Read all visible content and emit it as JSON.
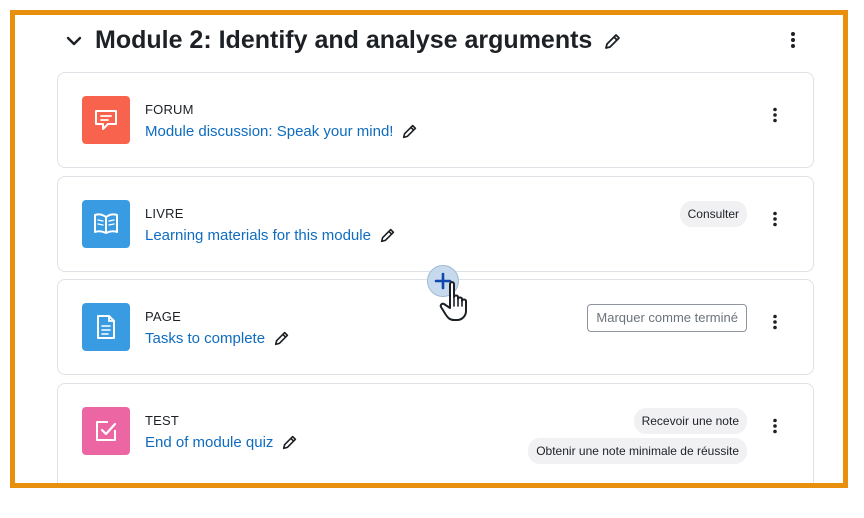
{
  "section": {
    "title": "Module 2: Identify and analyse arguments"
  },
  "activities": [
    {
      "type": "FORUM",
      "name": "Module discussion: Speak your mind!",
      "icon": "forum-icon",
      "color": "#f7634d"
    },
    {
      "type": "LIVRE",
      "name": "Learning materials for this module",
      "icon": "book-icon",
      "color": "#399be2",
      "badges": [
        "Consulter"
      ]
    },
    {
      "type": "PAGE",
      "name": "Tasks to complete",
      "icon": "page-icon",
      "color": "#399be2",
      "completion_button": "Marquer comme terminé"
    },
    {
      "type": "TEST",
      "name": "End of module quiz",
      "icon": "quiz-icon",
      "color": "#eb66a2",
      "badges": [
        "Recevoir une note",
        "Obtenir une note minimale de réussite"
      ]
    }
  ],
  "colors": {
    "frame": "#e8900e",
    "link": "#0f6cbf",
    "text": "#1d2125"
  }
}
